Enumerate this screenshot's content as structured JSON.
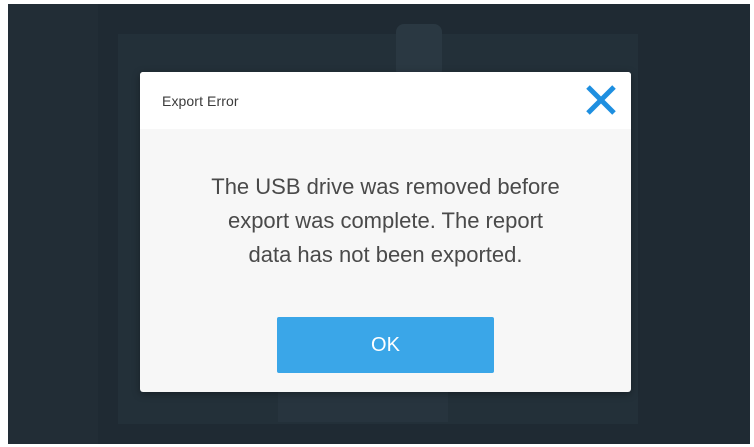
{
  "dialog": {
    "title": "Export Error",
    "message_lines": [
      "The USB drive was removed before",
      "export was complete. The report",
      "data has not been exported."
    ],
    "ok_label": "OK",
    "close_icon": "close-icon"
  },
  "colors": {
    "accent": "#3aa6e8",
    "overlay_background": "#1f2a33",
    "dialog_background": "#f7f7f7"
  }
}
